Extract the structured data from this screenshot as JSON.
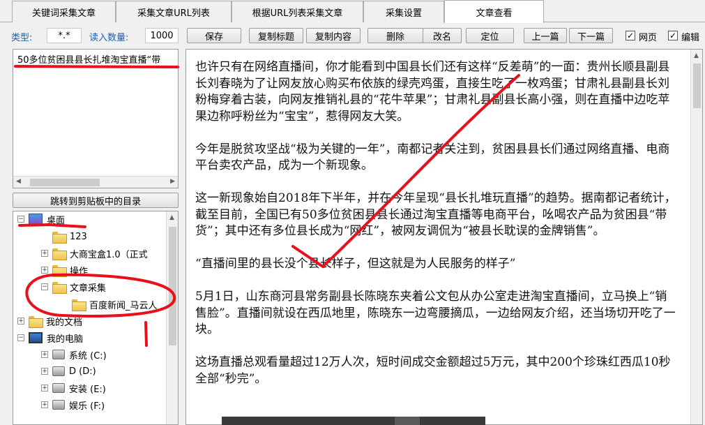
{
  "tabs": [
    {
      "label": "关键词采集文章"
    },
    {
      "label": "采集文章URL列表"
    },
    {
      "label": "根据URL列表采集文章"
    },
    {
      "label": "采集设置"
    },
    {
      "label": "文章查看",
      "active": true
    }
  ],
  "toolbar": {
    "type_label": "类型:",
    "type_value": "*.*",
    "count_label": "读入数量:",
    "count_value": "1000",
    "save": "保存",
    "copy_title": "复制标题",
    "copy_content": "复制内容",
    "delete": "删除",
    "rename": "改名",
    "locate": "定位",
    "prev": "上一篇",
    "next": "下一篇",
    "web_label": "网页",
    "web_checked": true,
    "edit_label": "编辑",
    "edit_checked": true
  },
  "file_list": {
    "items": [
      "50多位贫困县县长扎堆淘宝直播“带"
    ]
  },
  "jump_button": "跳转到剪贴板中的目录",
  "tree": [
    {
      "label": "桌面",
      "icon": "desktop-icon",
      "exp": "−"
    },
    {
      "label": "123",
      "icon": "folder-icon",
      "exp": ""
    },
    {
      "label": "大商宝盒1.0（正式",
      "icon": "folder-icon",
      "exp": "+"
    },
    {
      "label": "操作",
      "icon": "folder-icon",
      "exp": "+"
    },
    {
      "label": "文章采集",
      "icon": "folder-icon",
      "exp": "−"
    },
    {
      "label": "百度新闻_马云人",
      "icon": "open-folder-icon",
      "exp": ""
    },
    {
      "label": "我的文档",
      "icon": "folder-icon",
      "exp": "+"
    },
    {
      "label": "我的电脑",
      "icon": "computer-icon",
      "exp": "−"
    },
    {
      "label": "系统 (C:)",
      "icon": "drive-icon",
      "exp": "+"
    },
    {
      "label": "D (D:)",
      "icon": "drive-icon",
      "exp": "+"
    },
    {
      "label": "安装 (E:)",
      "icon": "drive-icon",
      "exp": "+"
    },
    {
      "label": "娱乐 (F:)",
      "icon": "drive-icon",
      "exp": "+"
    }
  ],
  "article": {
    "paragraphs": [
      "也许只有在网络直播间，你才能看到中国县长们还有这样“反差萌”的一面：贵州长顺县副县长刘春晓为了让网友放心购买布依族的绿壳鸡蛋，直接生吃了一枚鸡蛋；甘肃礼县副县长刘粉梅穿着古装，向网友推销礼县的“花牛苹果”；甘肃礼县副县长高小强，则在直播中边吃苹果边称呼粉丝为“宝宝”，惹得网友大笑。",
      "今年是脱贫攻坚战“极为关键的一年”，南都记者关注到，贫困县县长们通过网络直播、电商平台卖农产品，成为一个新现象。",
      "这一新现象始自2018年下半年，并在今年呈现“县长扎堆玩直播”的趋势。据南都记者统计，截至目前，全国已有50多位贫困县县长通过淘宝直播等电商平台，吆喝农产品为贫困县“带货”；其中还有多位县长成为“网红”，被网友调侃为“被县长耽误的金牌销售”。",
      "“直播间里的县长没个县长样子，但这就是为人民服务的样子”",
      "5月1日，山东商河县常务副县长陈晓东夹着公文包从办公室走进淘宝直播间，立马换上“销售脸”。直播间就设在西瓜地里，陈晓东一边弯腰摘瓜，一边给网友介绍，还当场切开吃了一块。",
      "这场直播总观看量超过12万人次，短时间成交金额超过5万元，其中200个珍珠红西瓜10秒全部“秒完”。"
    ]
  },
  "colors": {
    "annotation_red": "#e8101a",
    "label_blue": "#1e5fa8"
  }
}
